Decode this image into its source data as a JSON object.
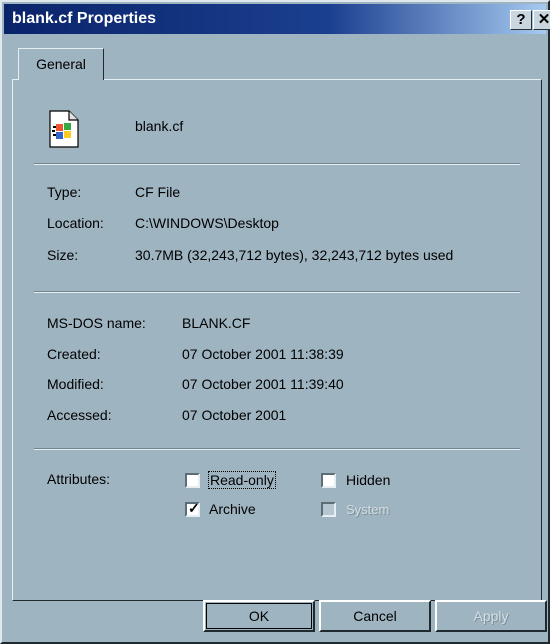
{
  "window": {
    "title": "blank.cf Properties"
  },
  "tabs": [
    {
      "label": "General"
    }
  ],
  "file": {
    "name": "blank.cf",
    "icon": "windows-file-icon"
  },
  "info": {
    "type_label": "Type:",
    "type_value": "CF File",
    "location_label": "Location:",
    "location_value": "C:\\WINDOWS\\Desktop",
    "size_label": "Size:",
    "size_value": "30.7MB (32,243,712 bytes), 32,243,712 bytes used"
  },
  "dates": {
    "msdos_label": "MS-DOS name:",
    "msdos_value": "BLANK.CF",
    "created_label": "Created:",
    "created_value": "07 October 2001 11:38:39",
    "modified_label": "Modified:",
    "modified_value": "07 October 2001 11:39:40",
    "accessed_label": "Accessed:",
    "accessed_value": "07 October 2001"
  },
  "attributes": {
    "label": "Attributes:",
    "readonly": {
      "label": "Read-only",
      "checked": false
    },
    "hidden": {
      "label": "Hidden",
      "checked": false
    },
    "archive": {
      "label": "Archive",
      "checked": true
    },
    "system": {
      "label": "System",
      "checked": false,
      "disabled": true
    }
  },
  "buttons": {
    "ok": "OK",
    "cancel": "Cancel",
    "apply": "Apply"
  },
  "titlebar": {
    "help": "?",
    "close": "✕"
  }
}
